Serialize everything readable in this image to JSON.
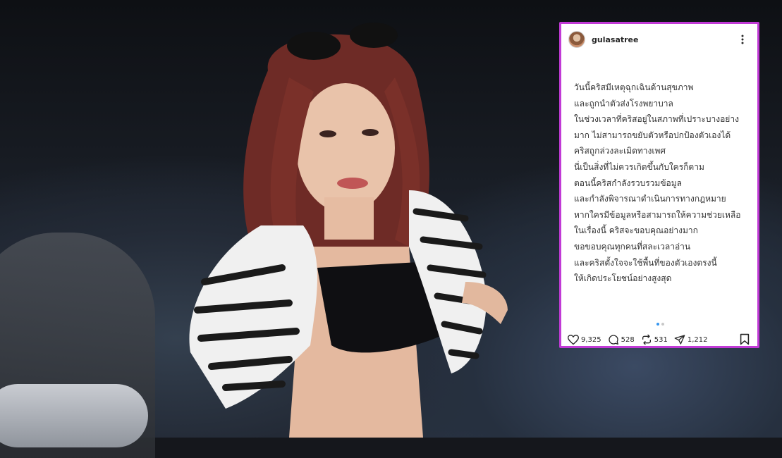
{
  "post": {
    "username": "gulasatree",
    "lines": [
      "วันนี้คริสมีเหตุฉุกเฉินด้านสุขภาพ",
      "และถูกนำตัวส่งโรงพยาบาล",
      "ในช่วงเวลาที่คริสอยู่ในสภาพที่เปราะบางอย่าง",
      "มาก ไม่สามารถขยับตัวหรือปกป้องตัวเองได้",
      "คริสถูกล่วงละเมิดทางเพศ",
      "นี่เป็นสิ่งที่ไม่ควรเกิดขึ้นกับใครก็ตาม",
      "ตอนนี้คริสกำลังรวบรวมข้อมูล",
      "และกำลังพิจารณาดำเนินการทางกฎหมาย",
      "หากใครมีข้อมูลหรือสามารถให้ความช่วยเหลือ",
      "ในเรื่องนี้ คริสจะขอบคุณอย่างมาก",
      "ขอขอบคุณทุกคนที่สละเวลาอ่าน",
      "และคริสตั้งใจจะใช้พื้นที่ของตัวเองตรงนี้",
      "ให้เกิดประโยชน์อย่างสูงสุด"
    ],
    "likes": "9,325",
    "comments": "528",
    "reposts": "531",
    "shares": "1,212"
  },
  "icons": {
    "more": "more-vertical-icon",
    "like": "heart-icon",
    "comment": "comment-icon",
    "repost": "repost-icon",
    "share": "share-icon",
    "save": "bookmark-icon"
  },
  "colors": {
    "card_border": "#c13ad6",
    "carousel_active": "#3897f0"
  }
}
